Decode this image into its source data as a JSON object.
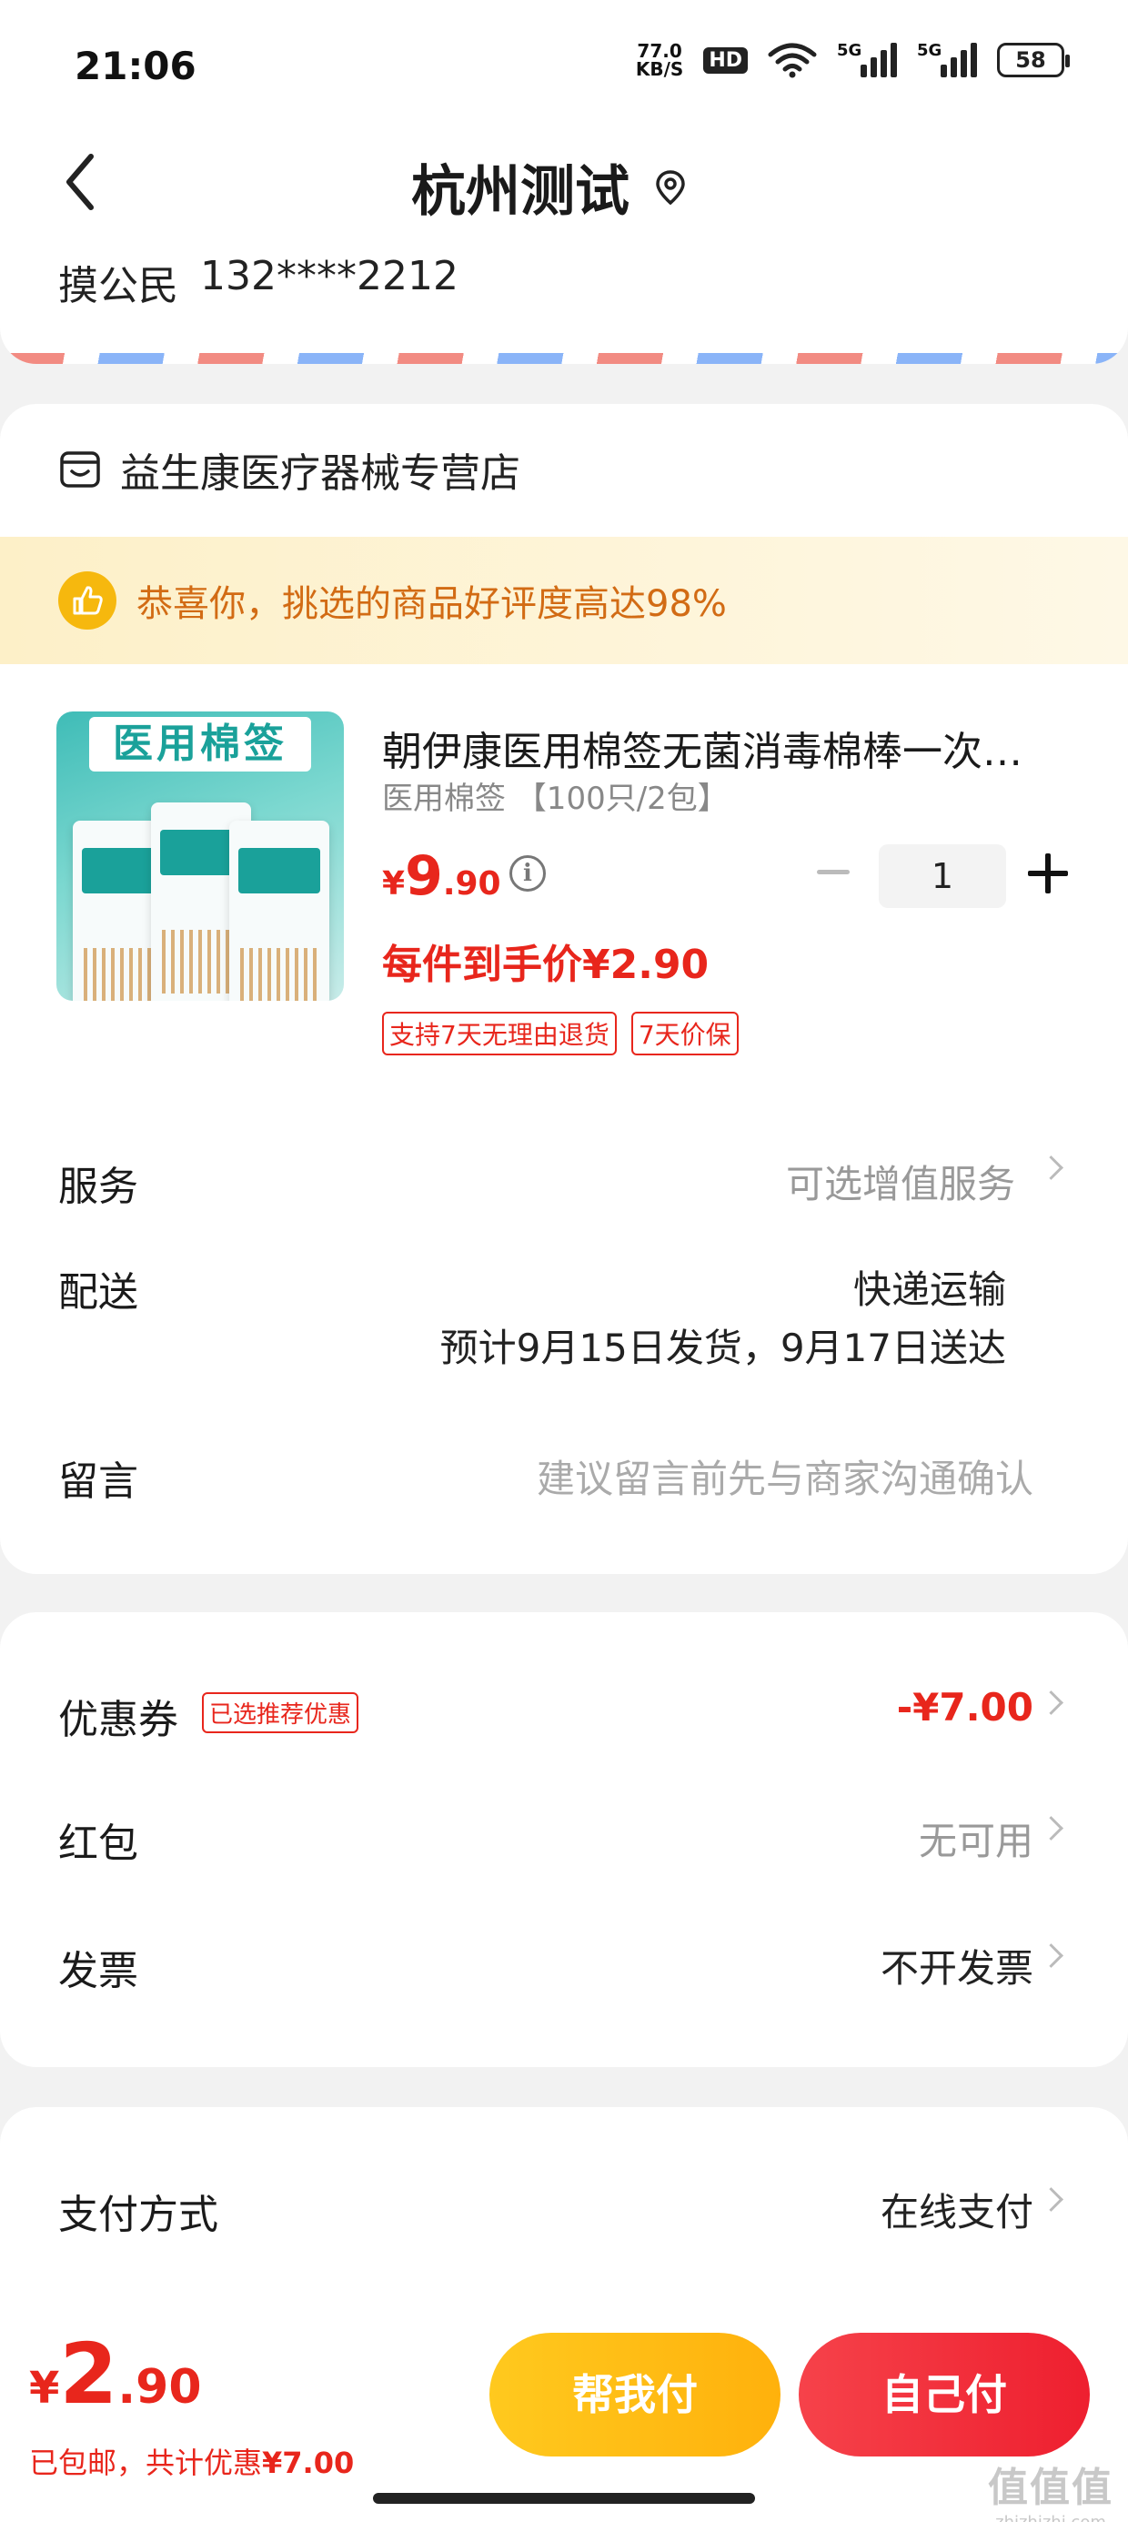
{
  "status_bar": {
    "time": "21:06",
    "net_speed_value": "77.0",
    "net_speed_unit": "KB/S",
    "hd_label": "HD",
    "sim1": "5G",
    "sim2": "5G",
    "battery": "58"
  },
  "header": {
    "title": "杭州测试",
    "recipient_name": "摸公民",
    "recipient_phone": "132****2212"
  },
  "shop": {
    "name": "益生康医疗器械专营店",
    "praise_text": "恭喜你，挑选的商品好评度高达98%"
  },
  "product": {
    "image_label": "医用棉签",
    "title": "朝伊康医用棉签无菌消毒棉棒一次…",
    "spec": "医用棉签 【100只/2包】",
    "price_currency": "¥",
    "price_int": "9",
    "price_dec": ".90",
    "quantity": "1",
    "final_price": "每件到手价¥2.90",
    "tags": [
      "支持7天无理由退货",
      "7天价保"
    ]
  },
  "order": {
    "service_label": "服务",
    "service_value": "可选增值服务",
    "delivery_label": "配送",
    "delivery_method": "快递运输",
    "delivery_eta": "预计9月15日发货，9月17日送达",
    "message_label": "留言",
    "message_placeholder": "建议留言前先与商家沟通确认"
  },
  "discount": {
    "coupon_label": "优惠券",
    "coupon_tag": "已选推荐优惠",
    "coupon_value": "-¥7.00",
    "redpack_label": "红包",
    "redpack_value": "无可用",
    "invoice_label": "发票",
    "invoice_value": "不开发票"
  },
  "payment": {
    "label": "支付方式",
    "value": "在线支付"
  },
  "bottom": {
    "currency": "¥",
    "total_int": "2",
    "total_dec": ".90",
    "note_prefix": "已包邮，共计优惠",
    "note_amount": "¥7.00",
    "help_pay": "帮我付",
    "self_pay": "自己付"
  },
  "watermark": {
    "logo": "值值值",
    "url": "zhizhizhi.com"
  },
  "colors": {
    "accent_red": "#e8261c",
    "accent_yellow": "#ffb10c",
    "praise_orange": "#d26b14"
  }
}
